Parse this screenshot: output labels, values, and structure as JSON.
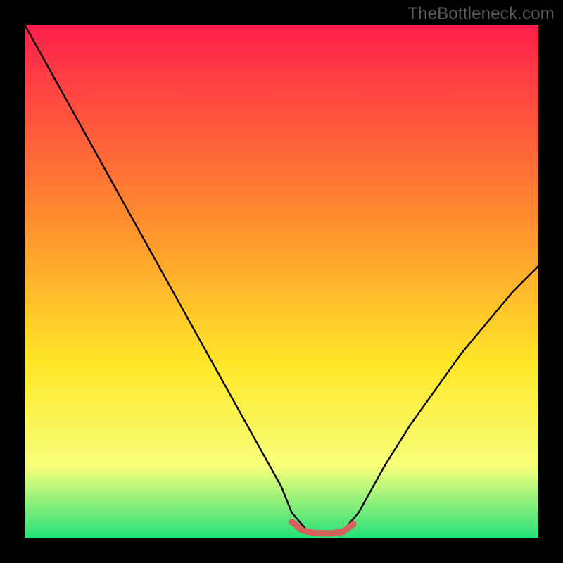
{
  "watermark": "TheBottleneck.com",
  "colors": {
    "gradient_top": "#ff1f4b",
    "gradient_mid1": "#ff8d2e",
    "gradient_mid2": "#ffe728",
    "gradient_mid3": "#f7ff7a",
    "gradient_bottom": "#24e07a",
    "curve": "#000000",
    "marker": "#d6605b"
  },
  "chart_data": {
    "type": "line",
    "title": "",
    "xlabel": "",
    "ylabel": "",
    "xlim": [
      0,
      100
    ],
    "ylim": [
      0,
      100
    ],
    "series": [
      {
        "name": "bottleneck-curve",
        "x": [
          0,
          5,
          10,
          15,
          20,
          25,
          30,
          35,
          40,
          45,
          50,
          52,
          55,
          58,
          60,
          62,
          65,
          70,
          75,
          80,
          85,
          90,
          95,
          100
        ],
        "values": [
          100,
          91,
          82,
          73,
          64,
          55,
          46,
          37,
          28,
          19,
          10,
          5,
          1.5,
          1.0,
          1.0,
          1.5,
          5,
          14,
          22,
          29,
          36,
          42,
          48,
          53
        ]
      }
    ],
    "marker_segment": {
      "name": "optimum-band",
      "x": [
        52,
        54,
        56,
        58,
        60,
        62,
        64
      ],
      "values": [
        3.2,
        1.6,
        1.1,
        1.0,
        1.0,
        1.3,
        2.8
      ]
    }
  }
}
